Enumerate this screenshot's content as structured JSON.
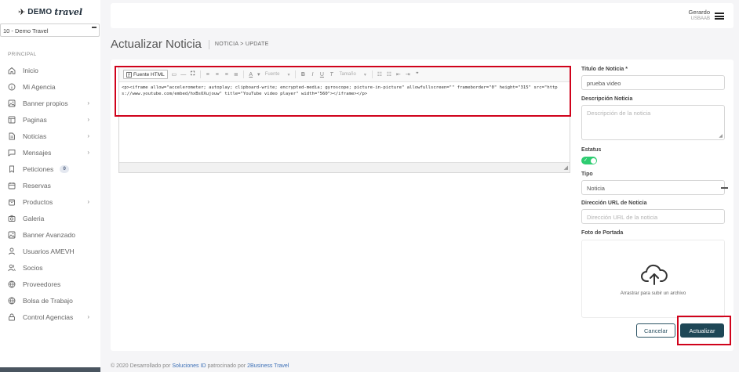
{
  "brand": {
    "logo_demo": "DEMO",
    "logo_travel": "travel",
    "logo_mark": "✈"
  },
  "agency_select": {
    "value": "10 - Demo Travel"
  },
  "sidebar": {
    "section_label": "PRINCIPAL",
    "items": [
      {
        "label": "Inicio",
        "icon": "home-icon",
        "chevron": false
      },
      {
        "label": "Mi Agencia",
        "icon": "info-icon",
        "chevron": false
      },
      {
        "label": "Banner propios",
        "icon": "image-icon",
        "chevron": true
      },
      {
        "label": "Paginas",
        "icon": "layout-icon",
        "chevron": true
      },
      {
        "label": "Noticias",
        "icon": "file-icon",
        "chevron": true
      },
      {
        "label": "Mensajes",
        "icon": "message-icon",
        "chevron": true
      },
      {
        "label": "Peticiones",
        "icon": "bookmark-icon",
        "chevron": false,
        "badge": "0"
      },
      {
        "label": "Reservas",
        "icon": "calendar-icon",
        "chevron": false
      },
      {
        "label": "Productos",
        "icon": "box-icon",
        "chevron": true
      },
      {
        "label": "Galeria",
        "icon": "camera-icon",
        "chevron": false
      },
      {
        "label": "Banner Avanzado",
        "icon": "image-icon",
        "chevron": false
      },
      {
        "label": "Usuarios AMEVH",
        "icon": "user-icon",
        "chevron": false
      },
      {
        "label": "Socios",
        "icon": "users-icon",
        "chevron": false
      },
      {
        "label": "Proveedores",
        "icon": "globe-icon",
        "chevron": false
      },
      {
        "label": "Bolsa de Trabajo",
        "icon": "globe-icon",
        "chevron": false
      },
      {
        "label": "Control Agencias",
        "icon": "lock-icon",
        "chevron": true
      }
    ]
  },
  "topbar": {
    "user_name": "Gerardo",
    "user_role": "USBAAB"
  },
  "header": {
    "title": "Actualizar Noticia",
    "breadcrumb": "NOTICIA > UPDATE"
  },
  "editor": {
    "source_label": "Fuente HTML",
    "font_dropdown": "Fuente",
    "size_dropdown": "Tamaño",
    "content": "<p><iframe allow=\"accelerometer; autoplay; clipboard-write; encrypted-media; gyroscope; picture-in-picture\" allowfullscreen=\"\" frameborder=\"0\" height=\"315\" src=\"https://www.youtube.com/embed/hxBsOXujouw\" title=\"YouTube video player\" width=\"560\"></iframe></p>"
  },
  "form": {
    "titulo_label": "Titulo de Noticia *",
    "titulo_value": "prueba video",
    "descripcion_label": "Descripción Noticia",
    "descripcion_placeholder": "Descripción de la noticia",
    "estatus_label": "Estatus",
    "estatus_on": true,
    "tipo_label": "Tipo",
    "tipo_value": "Noticia",
    "url_label": "Dirección URL de Noticia",
    "url_placeholder": "Dirección URL de la noticia",
    "portada_label": "Foto de Portada",
    "dropzone_text": "Arrastrar para subir un archivo"
  },
  "actions": {
    "cancel": "Cancelar",
    "update": "Actualizar"
  },
  "footer": {
    "prefix": "© 2020 Desarrollado por ",
    "link1": "Soluciones ID",
    "middle": " patrocinado por ",
    "link2": "2Business Travel"
  },
  "colors": {
    "accent": "#1e4756",
    "toggle": "#2ecc71",
    "highlight": "#d0021b",
    "link": "#3b6fb6"
  }
}
